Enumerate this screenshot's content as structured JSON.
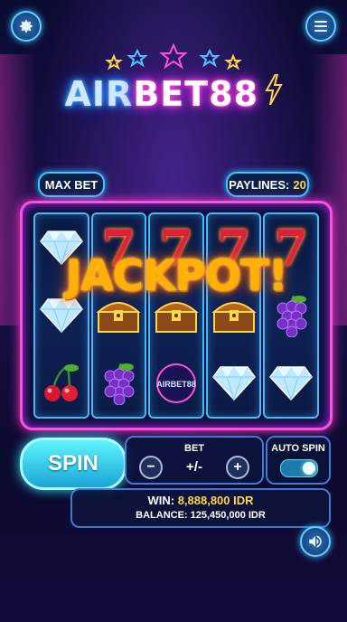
{
  "header": {
    "settings_icon": "gear-icon",
    "menu_icon": "hamburger-menu-icon"
  },
  "logo": {
    "part1": "AIR",
    "part2": "BET",
    "part3": "88"
  },
  "top_bar": {
    "max_bet_label": "MAX BET",
    "paylines_label": "PAYLINES:",
    "paylines_value": "20"
  },
  "reels": [
    [
      "diamond",
      "diamond",
      "cherries"
    ],
    [
      "seven",
      "treasure-chest",
      "grapes"
    ],
    [
      "seven",
      "treasure-chest",
      "airbet88-logo"
    ],
    [
      "seven",
      "treasure-chest",
      "diamond"
    ],
    [
      "seven",
      "grapes",
      "diamond"
    ]
  ],
  "reel_logo_text": "AIRBET88",
  "jackpot_text": "JACKPOT!",
  "controls": {
    "spin_label": "SPIN",
    "bet_label": "BET",
    "bet_value": "+/-",
    "minus_label": "−",
    "plus_label": "+",
    "auto_spin_label": "AUTO SPIN",
    "auto_spin_on": true
  },
  "info": {
    "win_label": "WIN:",
    "win_amount": "8,888,800 IDR",
    "balance_text": "BALANCE: 125,450,000 IDR"
  },
  "sound_icon": "speaker-icon",
  "colors": {
    "accent_pink": "#ff4fd8",
    "accent_cyan": "#3fc6ff",
    "gold": "#ffd54a"
  }
}
